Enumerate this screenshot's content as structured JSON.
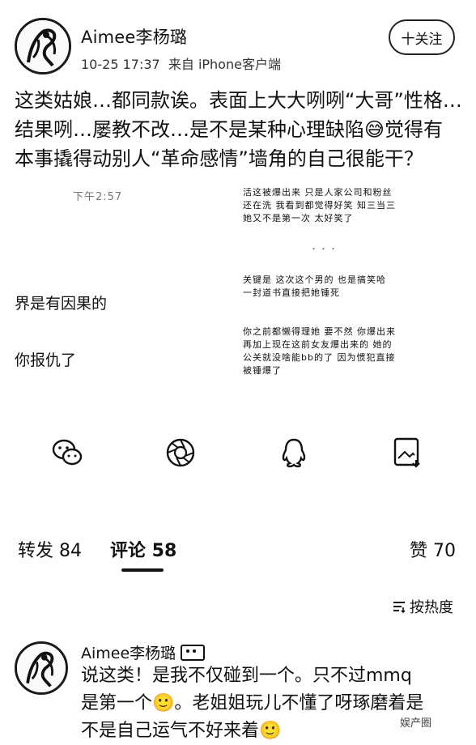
{
  "post": {
    "username": "Aimee李杨璐",
    "time": "10-25 17:37",
    "source": "来自 iPhone客户端",
    "follow_label": "十关注",
    "text_lines": [
      "这类姑娘…都同款诶。表面上大大咧咧“大哥”性格…",
      "结果咧…屡教不改…是不是某种心理缺陷😅觉得有",
      "本事撬得动别人“革命感情”墙角的自己很能干？"
    ]
  },
  "screenshot": {
    "left_time": "下午2:57",
    "left_line1": "界是有因果的",
    "left_line2": "你报仇了",
    "right_block1": [
      "活这被爆出来 只是人家公司和粉丝",
      "还在洗 我看到都觉得好笑 知三当三",
      "她又不是第一次 太好笑了"
    ],
    "right_block2": [
      "关键是 这次这个男的 也是搞笑哈",
      "一封道书直接把她锤死"
    ],
    "right_block3": [
      "你之前都懒得理她 要不然 你爆出来",
      "再加上现在这前女友爆出来的 她的",
      "公关就没啥能bb的了 因为惯犯直接",
      "被锤爆了"
    ],
    "dots": "・・・"
  },
  "share_icons": [
    "wechat-icon",
    "moments-icon",
    "qq-icon",
    "save-image-icon"
  ],
  "tabs": {
    "repost": "转发 84",
    "comment": "评论 58",
    "like": "赞 70"
  },
  "sort": {
    "label": "按热度"
  },
  "comment": {
    "username": "Aimee李杨璐",
    "lines": [
      "说这类！是我不仅碰到一个。只不过mmq",
      "是第一个🙂。老姐姐玩儿不懂了呀琢磨着是",
      "不是自己运气不好来着🙂"
    ],
    "watermark": "娱产圈"
  }
}
